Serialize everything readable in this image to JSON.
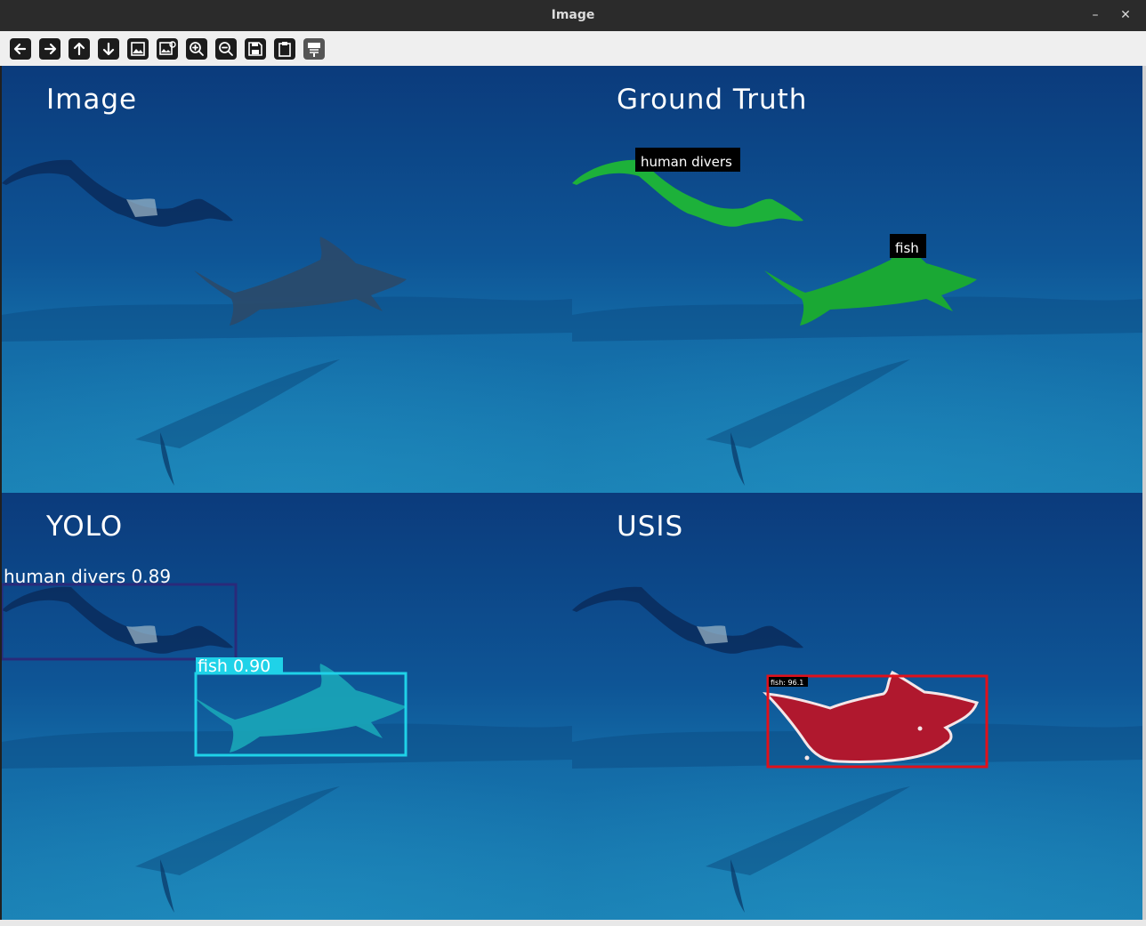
{
  "window": {
    "title": "Image",
    "minimize_glyph": "–",
    "close_glyph": "✕"
  },
  "toolbar": {
    "icons": [
      "arrow-left-icon",
      "arrow-right-icon",
      "arrow-up-icon",
      "arrow-down-icon",
      "image-icon",
      "image-settings-icon",
      "zoom-in-icon",
      "zoom-out-icon",
      "save-icon",
      "clipboard-icon",
      "properties-icon"
    ]
  },
  "panels": {
    "image": {
      "title": "Image"
    },
    "ground_truth": {
      "title": "Ground Truth",
      "labels": {
        "diver": "human divers",
        "fish": "fish"
      },
      "mask_color": "#1db13a"
    },
    "yolo": {
      "title": "YOLO",
      "labels": {
        "diver": "human divers 0.89",
        "fish": "fish 0.90"
      },
      "diver_box_color": "#2a2a7a",
      "fish_box_color": "#1fd2e8"
    },
    "usis": {
      "title": "USIS",
      "labels": {
        "fish": "fish: 96.1"
      },
      "mask_color": "#b0182e",
      "box_color": "#e0101a"
    }
  },
  "colors": {
    "water_top": "#0c3f82",
    "water_mid": "#0f5a9c",
    "seabed": "#1a7bb0"
  }
}
